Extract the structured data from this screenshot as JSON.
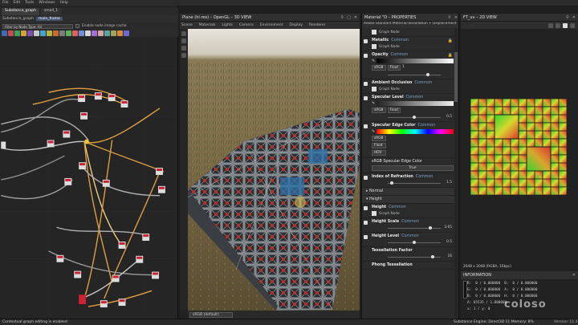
{
  "menubar": [
    "File",
    "Edit",
    "Tools",
    "Windows",
    "Help"
  ],
  "graph": {
    "tabs": [
      "Substance_graph",
      "small_1"
    ],
    "crumbs": [
      "Substance_graph",
      "main_frame"
    ],
    "filter_label": "Filter by Node Type: All",
    "cache_label": "Enable node image cache",
    "tool_colors": [
      "#3d6db3",
      "#c94b4b",
      "#3aa35a",
      "#d6a33a",
      "#7a52b3",
      "#c9c9c9",
      "#44a5c9",
      "#b3b33d",
      "#c96b2e",
      "#7d7d7d",
      "#5db35d",
      "#e06060",
      "#6f8fd6",
      "#d6d6d6",
      "#a56fd6",
      "#d6a3a3",
      "#5aa3a3",
      "#a3a35a",
      "#d68a3a",
      "#6a6ad6"
    ]
  },
  "view3d": {
    "title": "Plane (hi-res) – OpenGL – 3D VIEW",
    "menu": [
      "Scene",
      "Materials",
      "Lights",
      "Camera",
      "Environment",
      "Display",
      "Renderer"
    ],
    "colorspace": "sRGB (default)"
  },
  "props": {
    "title": "Material \"D – PROPERTIES",
    "subtitle": "Adobe Standard Material/Tessellation + Displacement",
    "graph_node": "Graph Node",
    "common": "Common",
    "metallic": "Metallic",
    "opacity": "Opacity",
    "opacity_value": "1",
    "opacity_level": 0.75,
    "ambient_occlusion": "Ambient Occlusion",
    "specular_level": "Specular Level",
    "specular_value": "0.5",
    "specular_level_pos": 0.5,
    "specular_edge_color": "Specular Edge Color",
    "srgb": "sRGB",
    "float": "Float",
    "hdv": "HDV",
    "srgb_specular": "sRGB Specular Edge Color",
    "true_label": "True",
    "ior": "Index of Refraction",
    "ior_value": "1.5",
    "ior_level": 0.08,
    "normal": "Normal",
    "height_section": "Height",
    "height": "Height",
    "height_scale": "Height Scale",
    "height_scale_value": "3.65",
    "height_scale_level": 0.8,
    "height_level": "Height Level",
    "height_level_value": "0.5",
    "height_level_pos": 0.5,
    "tessellation_factor": "Tessellation Factor",
    "tessellation_value": "16",
    "tessellation_level": 0.85,
    "phong": "Phong Tessellation"
  },
  "view2d": {
    "title": "FT_uv – 2D VIEW",
    "tex_info": "2048 x 2048 (RGBA, 16bpc)",
    "info_title": "INFORMATION",
    "info_rows": [
      [
        "R:",
        "0 / 0.000000",
        "B:",
        "0 / 0.000000"
      ],
      [
        "G:",
        "0 / 0.000000",
        "A:",
        "0 / 0.000000"
      ],
      [
        "B:",
        "0 / 0.000000",
        "H:",
        "0 / 0.000000"
      ],
      [
        "A: 65535 / 1.000000",
        "",
        "",
        ""
      ],
      [
        "x: 1 / y: 0",
        "",
        "",
        ""
      ]
    ]
  },
  "status": {
    "left": "Contextual graph editing is enabled",
    "right": "Substance Engine: Direct3D 11  Memory: 8%",
    "version": "Version: 11.3"
  },
  "watermark": "coloso"
}
